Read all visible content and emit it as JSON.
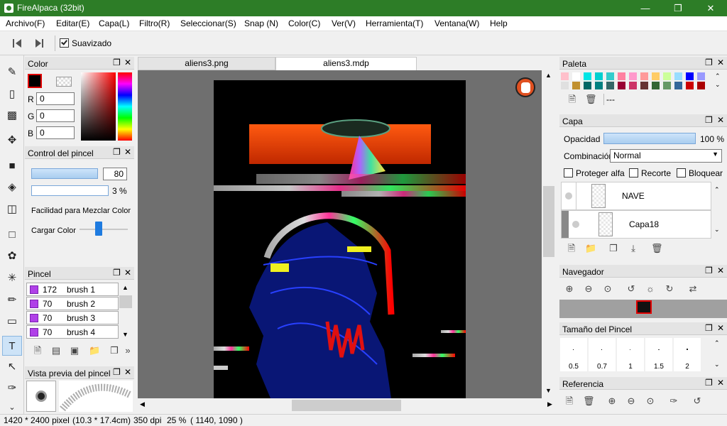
{
  "window": {
    "title": "FireAlpaca (32bit)",
    "minimize_icon": "minimize-icon",
    "maximize_icon": "maximize-icon",
    "close_icon": "close-icon"
  },
  "menu": [
    "Archivo(F)",
    "Editar(E)",
    "Capa(L)",
    "Filtro(R)",
    "Seleccionar(S)",
    "Snap (N)",
    "Color(C)",
    "Ver(V)",
    "Herramienta(T)",
    "Ventana(W)",
    "Help"
  ],
  "toolbar": {
    "smoothing_label": "Suavizado"
  },
  "tabs": [
    "aliens3.png",
    "aliens3.mdp"
  ],
  "color_panel": {
    "title": "Color",
    "r_label": "R",
    "g_label": "G",
    "b_label": "B",
    "r": "0",
    "g": "0",
    "b": "0"
  },
  "brush_control": {
    "title": "Control del pincel",
    "size_value": "80",
    "opacity_value": "3 %",
    "mix_label": "Facilidad para Mezclar Color",
    "load_label": "Cargar Color"
  },
  "brush_panel": {
    "title": "Pincel",
    "items": [
      {
        "size": "172",
        "name": "brush 1"
      },
      {
        "size": "70",
        "name": "brush 2"
      },
      {
        "size": "70",
        "name": "brush 3"
      },
      {
        "size": "70",
        "name": "brush 4"
      }
    ]
  },
  "brush_preview": {
    "title": "Vista previa del pincel"
  },
  "palette": {
    "title": "Paleta",
    "extra": "---",
    "colors_row1": [
      "#ffc0cb",
      "#ffffff",
      "#00e5e5",
      "#00d0d0",
      "#33cccc",
      "#ff80a0",
      "#ff99cc",
      "#ff9999",
      "#ffcc66",
      "#ccff99",
      "#99ddff",
      "#0000ff",
      "#9999ff"
    ],
    "colors_row2": [
      "#e0e0e0",
      "#c09030",
      "#006666",
      "#008080",
      "#336666",
      "#990033",
      "#cc3366",
      "#663333",
      "#336633",
      "#669966",
      "#336699",
      "#cc0000",
      "#aa0000"
    ]
  },
  "layer_panel": {
    "title": "Capa",
    "opacity_label": "Opacidad",
    "opacity_value": "100 %",
    "blend_label": "Combinación",
    "blend_value": "Normal",
    "alpha_label": "Proteger alfa",
    "clip_label": "Recorte",
    "lock_label": "Bloquear",
    "layers": [
      "NAVE",
      "Capa18"
    ]
  },
  "navigator": {
    "title": "Navegador"
  },
  "brush_size": {
    "title": "Tamaño del Pincel",
    "sizes": [
      "0.5",
      "0.7",
      "1",
      "1.5",
      "2"
    ]
  },
  "reference": {
    "title": "Referencia"
  },
  "status": {
    "dimensions": "1420 * 2400 pixel",
    "physical": "(10.3 * 17.4cm)",
    "dpi": "350 dpi",
    "zoom": "25 %",
    "cursor": "( 1140, 1090 )"
  }
}
